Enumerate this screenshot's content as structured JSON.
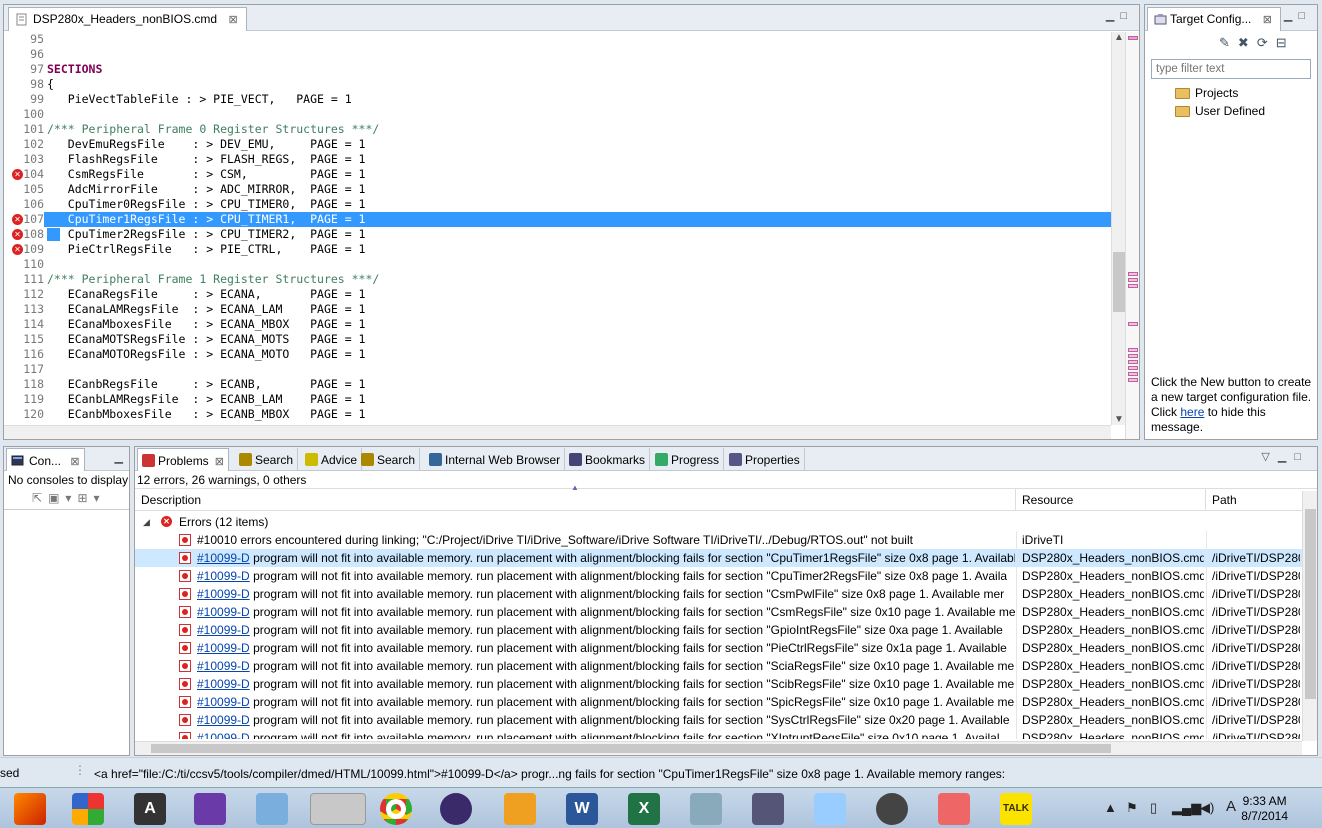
{
  "editor": {
    "tab_title": "DSP280x_Headers_nonBIOS.cmd",
    "tab_close": "⊠",
    "lines": [
      {
        "n": "95",
        "t": "",
        "err": false
      },
      {
        "n": "96",
        "t": "",
        "err": false
      },
      {
        "n": "97",
        "t": "SECTIONS",
        "err": false,
        "kw": true
      },
      {
        "n": "98",
        "t": "{",
        "err": false
      },
      {
        "n": "99",
        "t": "   PieVectTableFile : > PIE_VECT,   PAGE = 1",
        "err": false
      },
      {
        "n": "100",
        "t": "",
        "err": false
      },
      {
        "n": "101",
        "t": "/*** Peripheral Frame 0 Register Structures ***/",
        "err": false,
        "cm": true
      },
      {
        "n": "102",
        "t": "   DevEmuRegsFile    : > DEV_EMU,     PAGE = 1",
        "err": false
      },
      {
        "n": "103",
        "t": "   FlashRegsFile     : > FLASH_REGS,  PAGE = 1",
        "err": false
      },
      {
        "n": "104",
        "t": "   CsmRegsFile       : > CSM,         PAGE = 1",
        "err": true
      },
      {
        "n": "105",
        "t": "   AdcMirrorFile     : > ADC_MIRROR,  PAGE = 1",
        "err": false
      },
      {
        "n": "106",
        "t": "   CpuTimer0RegsFile : > CPU_TIMER0,  PAGE = 1",
        "err": false
      },
      {
        "n": "107",
        "t": "   CpuTimer1RegsFile : > CPU_TIMER1,  PAGE = 1",
        "err": true,
        "sel": true
      },
      {
        "n": "108",
        "t": "   CpuTimer2RegsFile : > CPU_TIMER2,  PAGE = 1",
        "err": true,
        "mark": true
      },
      {
        "n": "109",
        "t": "   PieCtrlRegsFile   : > PIE_CTRL,    PAGE = 1",
        "err": true
      },
      {
        "n": "110",
        "t": "",
        "err": false
      },
      {
        "n": "111",
        "t": "/*** Peripheral Frame 1 Register Structures ***/",
        "err": false,
        "cm": true
      },
      {
        "n": "112",
        "t": "   ECanaRegsFile     : > ECANA,       PAGE = 1",
        "err": false
      },
      {
        "n": "113",
        "t": "   ECanaLAMRegsFile  : > ECANA_LAM    PAGE = 1",
        "err": false
      },
      {
        "n": "114",
        "t": "   ECanaMboxesFile   : > ECANA_MBOX   PAGE = 1",
        "err": false
      },
      {
        "n": "115",
        "t": "   ECanaMOTSRegsFile : > ECANA_MOTS   PAGE = 1",
        "err": false
      },
      {
        "n": "116",
        "t": "   ECanaMOTORegsFile : > ECANA_MOTO   PAGE = 1",
        "err": false
      },
      {
        "n": "117",
        "t": "",
        "err": false
      },
      {
        "n": "118",
        "t": "   ECanbRegsFile     : > ECANB,       PAGE = 1",
        "err": false
      },
      {
        "n": "119",
        "t": "   ECanbLAMRegsFile  : > ECANB_LAM    PAGE = 1",
        "err": false
      },
      {
        "n": "120",
        "t": "   ECanbMboxesFile   : > ECANB_MBOX   PAGE = 1",
        "err": false
      }
    ]
  },
  "target": {
    "tab_title": "Target Config...",
    "filter_placeholder": "type filter text",
    "items": [
      "Projects",
      "User Defined"
    ],
    "help_pre": "Click the New button to create a new target configuration file. Click ",
    "help_link": "here",
    "help_post": " to hide this message."
  },
  "console": {
    "tab_title": "Con...",
    "message": "No consoles to display"
  },
  "problems": {
    "tabs": [
      "Problems",
      "Search",
      "Advice",
      "Search",
      "Internal Web Browser",
      "Bookmarks",
      "Progress",
      "Properties"
    ],
    "summary": "12 errors, 26 warnings, 0 others",
    "columns": [
      "Description",
      "Resource",
      "Path"
    ],
    "group": "Errors (12 items)",
    "rows": [
      {
        "code": "",
        "desc": "#10010 errors encountered during linking; \"C:/Project/iDrive TI/iDrive_Software/iDrive Software TI/iDriveTI/../Debug/RTOS.out\" not built",
        "res": "iDriveTI",
        "path": ""
      },
      {
        "code": "#10099-D",
        "desc": "program will not fit into available memory.  run placement with alignment/blocking fails for section \"CpuTimer1RegsFile\" size 0x8 page 1.  Available",
        "res": "DSP280x_Headers_nonBIOS.cmd",
        "path": "/iDriveTI/DSP280",
        "sel": true
      },
      {
        "code": "#10099-D",
        "desc": "program will not fit into available memory.  run placement with alignment/blocking fails for section \"CpuTimer2RegsFile\" size 0x8 page 1.  Availa",
        "res": "DSP280x_Headers_nonBIOS.cmd",
        "path": "/iDriveTI/DSP280"
      },
      {
        "code": "#10099-D",
        "desc": "program will not fit into available memory.  run placement with alignment/blocking fails for section \"CsmPwlFile\" size 0x8 page 1.  Available mer",
        "res": "DSP280x_Headers_nonBIOS.cmd",
        "path": "/iDriveTI/DSP280"
      },
      {
        "code": "#10099-D",
        "desc": "program will not fit into available memory.  run placement with alignment/blocking fails for section \"CsmRegsFile\" size 0x10 page 1.  Available me",
        "res": "DSP280x_Headers_nonBIOS.cmd",
        "path": "/iDriveTI/DSP280"
      },
      {
        "code": "#10099-D",
        "desc": "program will not fit into available memory.  run placement with alignment/blocking fails for section \"GpioIntRegsFile\" size 0xa page 1.  Available",
        "res": "DSP280x_Headers_nonBIOS.cmd",
        "path": "/iDriveTI/DSP280"
      },
      {
        "code": "#10099-D",
        "desc": "program will not fit into available memory.  run placement with alignment/blocking fails for section \"PieCtrlRegsFile\" size 0x1a page 1.  Available",
        "res": "DSP280x_Headers_nonBIOS.cmd",
        "path": "/iDriveTI/DSP280"
      },
      {
        "code": "#10099-D",
        "desc": "program will not fit into available memory.  run placement with alignment/blocking fails for section \"SciaRegsFile\" size 0x10 page 1.  Available me",
        "res": "DSP280x_Headers_nonBIOS.cmd",
        "path": "/iDriveTI/DSP280"
      },
      {
        "code": "#10099-D",
        "desc": "program will not fit into available memory.  run placement with alignment/blocking fails for section \"ScibRegsFile\" size 0x10 page 1.  Available me",
        "res": "DSP280x_Headers_nonBIOS.cmd",
        "path": "/iDriveTI/DSP280"
      },
      {
        "code": "#10099-D",
        "desc": "program will not fit into available memory.  run placement with alignment/blocking fails for section \"SpicRegsFile\" size 0x10 page 1.  Available me",
        "res": "DSP280x_Headers_nonBIOS.cmd",
        "path": "/iDriveTI/DSP280"
      },
      {
        "code": "#10099-D",
        "desc": "program will not fit into available memory.  run placement with alignment/blocking fails for section \"SysCtrlRegsFile\" size 0x20 page 1.  Available",
        "res": "DSP280x_Headers_nonBIOS.cmd",
        "path": "/iDriveTI/DSP280"
      },
      {
        "code": "#10099-D",
        "desc": "program will not fit into available memory.  run placement with alignment/blocking fails for section \"XIntruptRegsFile\" size 0x10 page 1.  Availal",
        "res": "DSP280x_Headers_nonBIOS.cmd",
        "path": "/iDriveTI/DSP280"
      }
    ]
  },
  "statusbar": {
    "left": "sed",
    "message": "<a href=\"file:/C:/ti/ccsv5/tools/compiler/dmed/HTML/10099.html\">#10099-D</a>  progr...ng fails for section \"CpuTimer1RegsFile\" size 0x8 page 1.  Available memory ranges:"
  },
  "taskbar": {
    "time": "9:33 AM",
    "date": "8/7/2014",
    "lang": "A"
  }
}
